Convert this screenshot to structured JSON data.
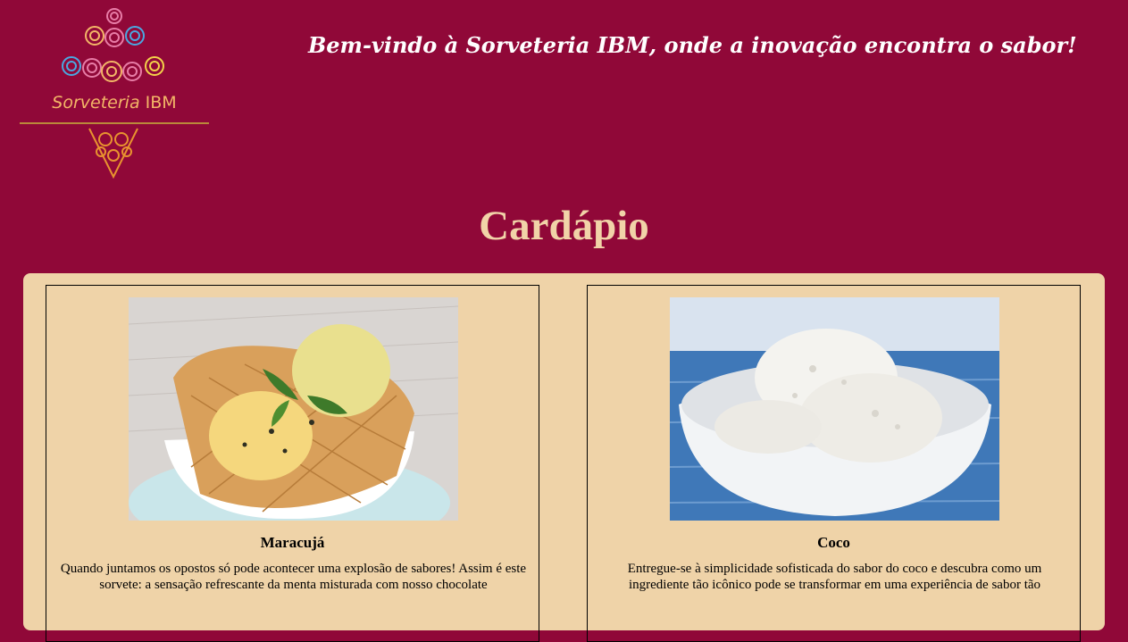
{
  "header": {
    "logo_text": "Sorveteria",
    "logo_text_brand": "IBM",
    "welcome": "Bem-vindo à Sorveteria IBM, onde a inovação encontra o sabor!"
  },
  "menu": {
    "title": "Cardápio",
    "items": [
      {
        "name": "Maracujá",
        "description": "Quando juntamos os opostos só pode acontecer uma explosão de sabores! Assim é este sorvete: a sensação refrescante da menta misturada com nosso chocolate"
      },
      {
        "name": "Coco",
        "description": "Entregue-se à simplicidade sofisticada do sabor do coco e descubra como um ingrediente tão icônico pode se transformar em uma experiência de sabor tão"
      }
    ]
  },
  "colors": {
    "background": "#900838",
    "panel": "#efd3a8",
    "title": "#f1d3a8",
    "logo_accent": "#f3b667"
  }
}
